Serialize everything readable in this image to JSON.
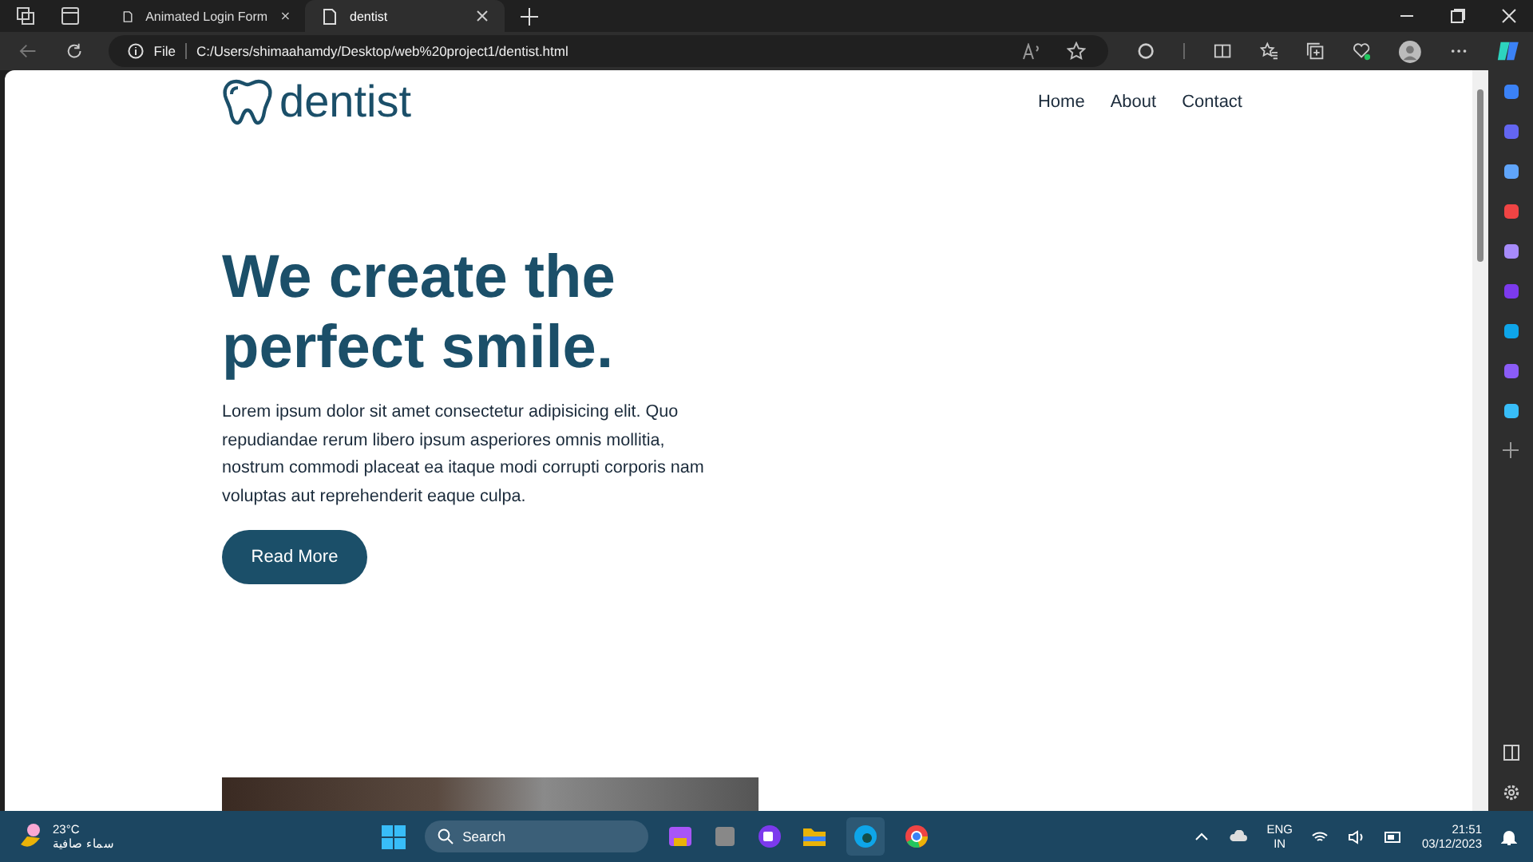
{
  "tabs": [
    {
      "title": "Animated Login Form",
      "selected": false
    },
    {
      "title": "dentist",
      "selected": true
    }
  ],
  "address": {
    "scheme": "File",
    "url": "C:/Users/shimaahamdy/Desktop/web%20project1/dentist.html"
  },
  "page": {
    "logo": "dentist",
    "nav": [
      "Home",
      "About",
      "Contact"
    ],
    "headline": "We create the perfect smile.",
    "text": "Lorem ipsum dolor sit amet consectetur adipisicing elit. Quo repudiandae rerum libero ipsum asperiores omnis mollitia, nostrum commodi placeat ea itaque modi corrupti corporis nam voluptas aut reprehenderit eaque culpa.",
    "button": "Read More"
  },
  "taskbar": {
    "temperature": "23°C",
    "condition": "سماء صافية",
    "search": "Search",
    "language": "ENG",
    "region": "IN",
    "time": "21:51",
    "date": "03/12/2023"
  }
}
